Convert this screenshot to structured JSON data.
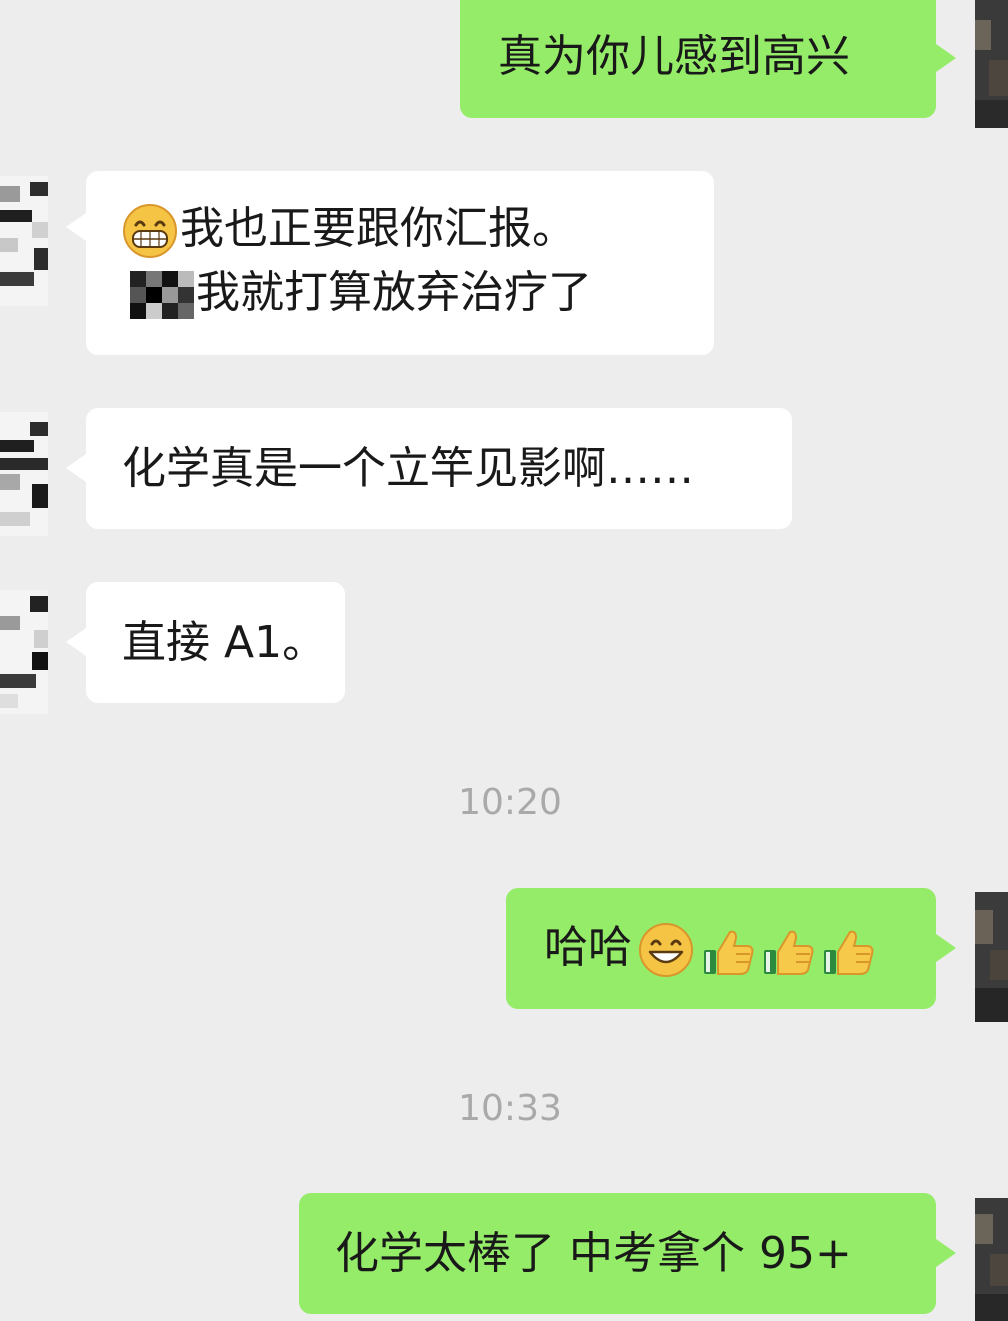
{
  "messages": [
    {
      "side": "sent",
      "text": "真为你儿感到高兴"
    },
    {
      "side": "received",
      "emoji": "grin-emoji",
      "line1": "我也正要跟你汇报。",
      "line2": "我就打算放弃治疗了"
    },
    {
      "side": "received",
      "text": "化学真是一个立竿见影啊……"
    },
    {
      "side": "received",
      "text": "直接 A1。"
    },
    {
      "side": "sent",
      "text": "哈哈",
      "emojis": [
        "smile-emoji",
        "thumbs-up-icon",
        "thumbs-up-icon",
        "thumbs-up-icon"
      ]
    },
    {
      "side": "sent",
      "text": "化学太棒了 中考拿个 95+"
    }
  ],
  "timestamps": [
    "10:20",
    "10:33"
  ],
  "colors": {
    "background": "#ededed",
    "sent_bubble": "#95ec69",
    "received_bubble": "#ffffff",
    "timestamp_text": "#a9a9a9"
  }
}
